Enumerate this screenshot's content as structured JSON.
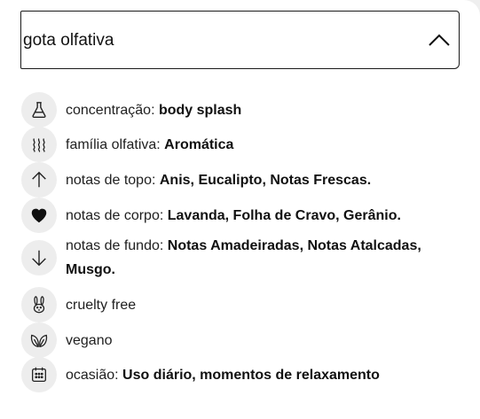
{
  "accordion": {
    "title": "gota olfativa",
    "expanded": true,
    "chevron_icon": "chevron-up-icon"
  },
  "items": [
    {
      "icon": "flask-icon",
      "label": "concentração:",
      "value": "body splash"
    },
    {
      "icon": "waves-icon",
      "label": "família olfativa:",
      "value": "Aromática"
    },
    {
      "icon": "arrow-up-icon",
      "label": "notas de topo:",
      "value": "Anis, Eucalipto, Notas Frescas."
    },
    {
      "icon": "heart-icon",
      "label": "notas de corpo:",
      "value": "Lavanda, Folha de Cravo, Gerânio."
    },
    {
      "icon": "arrow-down-icon",
      "label": "notas de fundo:",
      "value": "Notas Amadeiradas, Notas Atalcadas, Musgo."
    },
    {
      "icon": "rabbit-icon",
      "label": "cruelty free",
      "value": ""
    },
    {
      "icon": "leaves-icon",
      "label": "vegano",
      "value": ""
    },
    {
      "icon": "calendar-icon",
      "label": "ocasião:",
      "value": "Uso diário, momentos de relaxamento"
    }
  ]
}
